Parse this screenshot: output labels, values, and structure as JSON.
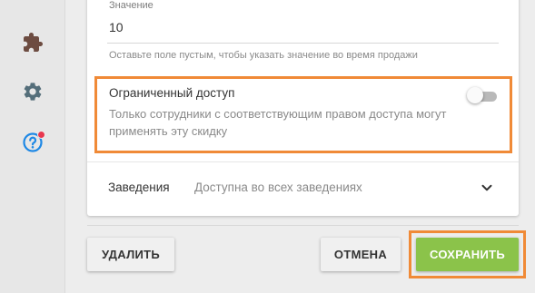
{
  "sidebar": {
    "icons": [
      {
        "name": "puzzle-icon",
        "color": "#6d4c41"
      },
      {
        "name": "gear-icon",
        "color": "#546e7a"
      },
      {
        "name": "help-icon",
        "color": "#1e88e5",
        "badge_color": "#e8384f"
      }
    ]
  },
  "form": {
    "value_field": {
      "label": "Значение",
      "value": "10",
      "hint": "Оставьте поле пустым, чтобы указать значение во время продажи"
    },
    "restricted_access": {
      "title": "Ограниченный доступ",
      "description": "Только сотрудники с соответствующим правом доступа могут применять эту скидку",
      "enabled": false
    },
    "venues": {
      "label": "Заведения",
      "value": "Доступна во всех заведениях"
    }
  },
  "actions": {
    "delete_label": "Удалить",
    "cancel_label": "Отмена",
    "save_label": "Сохранить"
  },
  "colors": {
    "highlight": "#f08a37",
    "save_button": "#8bc34a"
  }
}
